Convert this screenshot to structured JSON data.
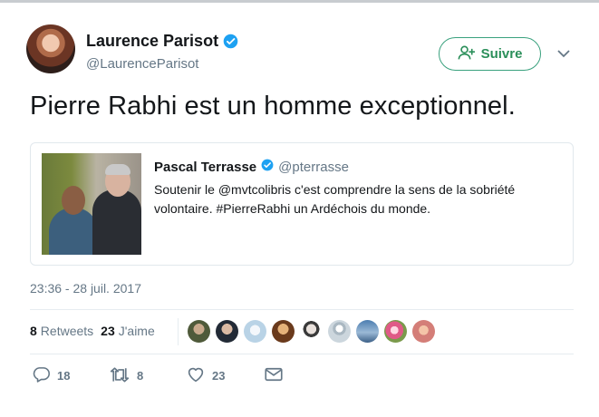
{
  "author": {
    "name": "Laurence Parisot",
    "handle": "@LaurenceParisot"
  },
  "follow_label": "Suivre",
  "tweet_text": "Pierre Rabhi est un homme exceptionnel.",
  "quoted": {
    "name": "Pascal Terrasse",
    "handle": "@pterrasse",
    "text": "Soutenir le @mvtcolibris c'est comprendre la sens de la sobriété volontaire. #PierreRabhi un Ardéchois du monde."
  },
  "timestamp": "23:36 - 28 juil. 2017",
  "stats": {
    "retweets_count": "8",
    "retweets_label": "Retweets",
    "likes_count": "23",
    "likes_label": "J'aime"
  },
  "actions": {
    "replies": "18",
    "retweets": "8",
    "likes": "23"
  },
  "colors": {
    "verified": "#1da1f2",
    "follow": "#2b8f5a"
  },
  "icons": [
    "verified-icon",
    "follow-user-icon",
    "chevron-down-icon",
    "reply-icon",
    "retweet-icon",
    "heart-icon",
    "dm-icon"
  ]
}
